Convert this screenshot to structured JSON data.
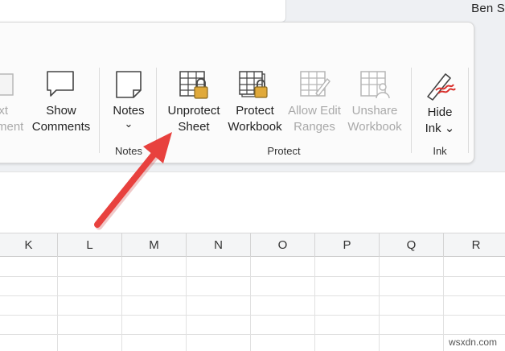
{
  "titlebar": {
    "user": "Ben S"
  },
  "ribbon": {
    "buttons": {
      "partial": {
        "line1": "ext",
        "line2": "ment"
      },
      "show_comments": {
        "line1": "Show",
        "line2": "Comments"
      },
      "notes": {
        "line1": "Notes",
        "line2": "⌄"
      },
      "unprotect_sheet": {
        "line1": "Unprotect",
        "line2": "Sheet"
      },
      "protect_workbook": {
        "line1": "Protect",
        "line2": "Workbook"
      },
      "allow_edit_ranges": {
        "line1": "Allow Edit",
        "line2": "Ranges"
      },
      "unshare_workbook": {
        "line1": "Unshare",
        "line2": "Workbook"
      },
      "hide_ink": {
        "line1": "Hide",
        "line2": "Ink ⌄"
      }
    },
    "groups": {
      "notes": "Notes",
      "protect": "Protect",
      "ink": "Ink"
    }
  },
  "columns": [
    "K",
    "L",
    "M",
    "N",
    "O",
    "P",
    "Q",
    "R"
  ],
  "watermark": "wsxdn.com",
  "colors": {
    "arrow": "#e8413e",
    "lock": "#e0a93a",
    "ink_pen": "#d9302c"
  }
}
